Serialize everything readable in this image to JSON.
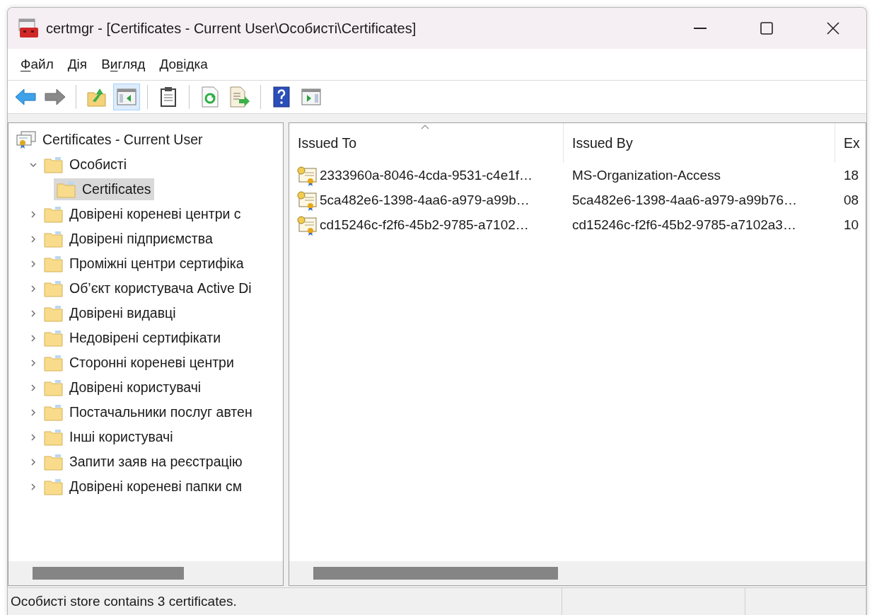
{
  "window": {
    "title": "certmgr - [Certificates - Current User\\Особисті\\Certificates]"
  },
  "menu": [
    {
      "key": "Ф",
      "post": "айл"
    },
    {
      "key": "Д",
      "post": "ія"
    },
    {
      "pre": "В",
      "key": "и",
      "post": "гляд"
    },
    {
      "pre": "До",
      "key": "в",
      "post": "ідка"
    }
  ],
  "toolbar": [
    {
      "kind": "back",
      "pressed": false
    },
    {
      "kind": "forward",
      "pressed": false
    },
    {
      "kind": "separator"
    },
    {
      "kind": "up",
      "pressed": false
    },
    {
      "kind": "tree-toggle",
      "pressed": true
    },
    {
      "kind": "separator"
    },
    {
      "kind": "clipboard",
      "pressed": false
    },
    {
      "kind": "separator"
    },
    {
      "kind": "refresh",
      "pressed": false
    },
    {
      "kind": "export",
      "pressed": false
    },
    {
      "kind": "separator"
    },
    {
      "kind": "help",
      "pressed": false
    },
    {
      "kind": "pane",
      "pressed": false
    }
  ],
  "tree": [
    {
      "kind": "root",
      "label": "Certificates - Current User",
      "selected": false,
      "children": [
        {
          "kind": "folder",
          "label": "Особисті",
          "expanded": true,
          "selected": false,
          "children": [
            {
              "kind": "folder",
              "label": "Certificates",
              "selected": true
            }
          ]
        },
        {
          "kind": "folder",
          "label": "Довірені кореневі центри с",
          "expanded": false,
          "selected": false
        },
        {
          "kind": "folder",
          "label": "Довірені підприємства",
          "expanded": false,
          "selected": false
        },
        {
          "kind": "folder",
          "label": "Проміжні центри сертифіка",
          "expanded": false,
          "selected": false
        },
        {
          "kind": "folder",
          "label": "Об’єкт користувача Active Di",
          "expanded": false,
          "selected": false
        },
        {
          "kind": "folder",
          "label": "Довірені видавці",
          "expanded": false,
          "selected": false
        },
        {
          "kind": "folder",
          "label": "Недовірені сертифікати",
          "expanded": false,
          "selected": false
        },
        {
          "kind": "folder",
          "label": "Сторонні кореневі центри",
          "expanded": false,
          "selected": false
        },
        {
          "kind": "folder",
          "label": "Довірені користувачі",
          "expanded": false,
          "selected": false
        },
        {
          "kind": "folder",
          "label": "Постачальники послуг автен",
          "expanded": false,
          "selected": false
        },
        {
          "kind": "folder",
          "label": "Інші користувачі",
          "expanded": false,
          "selected": false
        },
        {
          "kind": "folder",
          "label": "Запити заяв на реєстрацію",
          "expanded": false,
          "selected": false
        },
        {
          "kind": "folder",
          "label": "Довірені кореневі папки см",
          "expanded": false,
          "selected": false
        }
      ]
    }
  ],
  "table": {
    "columns": [
      {
        "label": "Issued To",
        "sorted": true
      },
      {
        "label": "Issued By"
      },
      {
        "label": "Ex"
      }
    ],
    "rows": [
      [
        "2333960a-8046-4cda-9531-c4e1f…",
        "MS-Organization-Access",
        "18"
      ],
      [
        "5ca482e6-1398-4aa6-a979-a99b…",
        "5ca482e6-1398-4aa6-a979-a99b76…",
        "08"
      ],
      [
        "cd15246c-f2f6-45b2-9785-a7102…",
        "cd15246c-f2f6-45b2-9785-a7102a3…",
        "10"
      ]
    ]
  },
  "status_bar": {
    "text": "Особисті store contains 3 certificates."
  }
}
